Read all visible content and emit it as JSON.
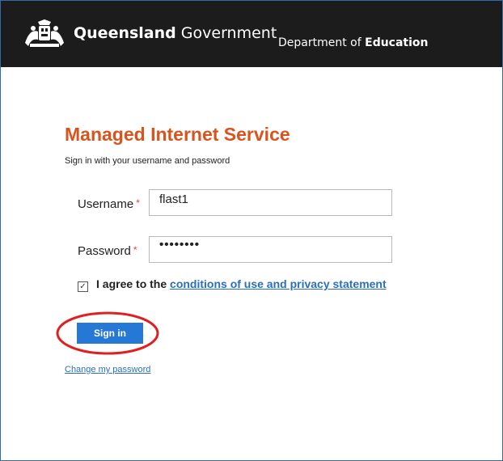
{
  "header": {
    "brand_bold": "Queensland",
    "brand_rest": "Government",
    "dept_prefix": "Department of",
    "dept_bold": "Education",
    "crest_icon": "queensland-crest-icon",
    "background": "#1c1c1c"
  },
  "form": {
    "title": "Managed Internet Service",
    "subtitle": "Sign in with your username and password",
    "username_label": "Username",
    "username_value": "flast1",
    "password_label": "Password",
    "password_value": "••••••••",
    "required_marker": "*",
    "agree_checked": true,
    "agree_text": "I agree to the",
    "agree_link": "conditions of use and privacy statement",
    "signin_label": "Sign in",
    "change_password_label": "Change my password"
  },
  "annotation": {
    "highlight_color": "#e02020",
    "highlight_shape": "ellipse"
  },
  "colors": {
    "title": "#d9531e",
    "button": "#2578d5",
    "link": "#2a6fbd"
  }
}
